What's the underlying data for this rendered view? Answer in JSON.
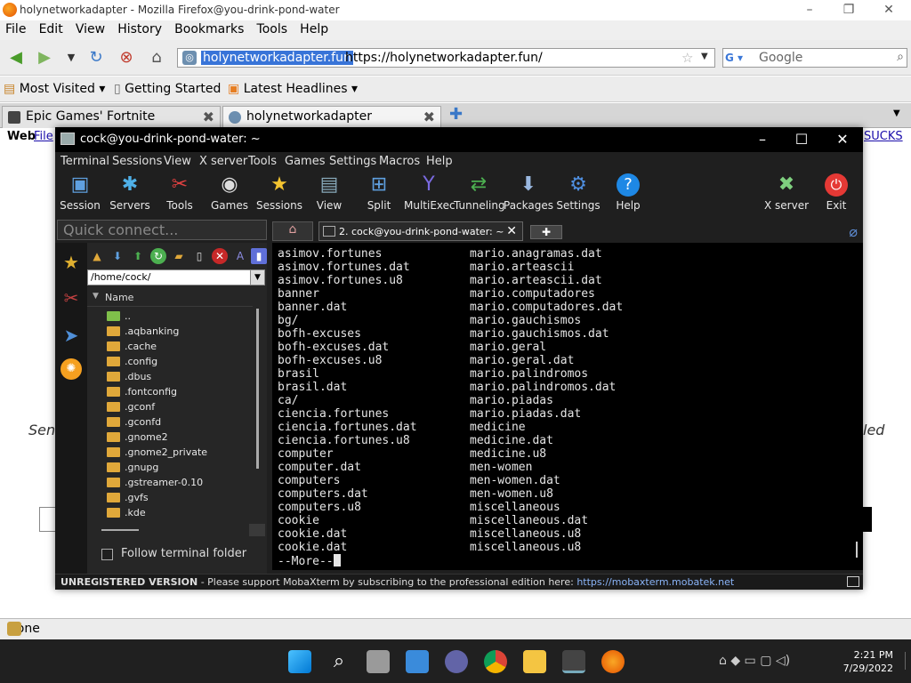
{
  "firefox": {
    "title": "holynetworkadapter - Mozilla Firefox@you-drink-pond-water",
    "menu": [
      "File",
      "Edit",
      "View",
      "History",
      "Bookmarks",
      "Tools",
      "Help"
    ],
    "url_selected": "holynetworkadapter.fun",
    "url": "https://holynetworkadapter.fun/",
    "search_placeholder": "Google",
    "bookmarks": [
      "Most Visited",
      "Getting Started",
      "Latest Headlines"
    ],
    "tabs": [
      {
        "label": "Epic Games' Fortnite",
        "active": false
      },
      {
        "label": "holynetworkadapter",
        "active": true
      }
    ],
    "status": "Done",
    "page_fragments": {
      "web": "Web",
      "file": "File",
      "sucks": "SUCKS",
      "sen": "Sen",
      "led": "led"
    }
  },
  "taskbar": {
    "time": "2:21 PM",
    "date": "7/29/2022"
  },
  "moba": {
    "title": "cock@you-drink-pond-water: ~",
    "menu": [
      "Terminal",
      "Sessions",
      "View",
      "X server",
      "Tools",
      "Games",
      "Settings",
      "Macros",
      "Help"
    ],
    "tools": [
      "Session",
      "Servers",
      "Tools",
      "Games",
      "Sessions",
      "View",
      "Split",
      "MultiExec",
      "Tunneling",
      "Packages",
      "Settings",
      "Help"
    ],
    "tools_right": [
      "X server",
      "Exit"
    ],
    "quick_connect": "Quick connect...",
    "tab_label": "2. cock@you-drink-pond-water: ~",
    "path": "/home/cock/",
    "name_header": "Name",
    "files": [
      "..",
      ".aqbanking",
      ".cache",
      ".config",
      ".dbus",
      ".fontconfig",
      ".gconf",
      ".gconfd",
      ".gnome2",
      ".gnome2_private",
      ".gnupg",
      ".gstreamer-0.10",
      ".gvfs",
      ".kde"
    ],
    "follow_label": "Follow terminal folder",
    "terminal_left": [
      "asimov.fortunes",
      "asimov.fortunes.dat",
      "asimov.fortunes.u8",
      "banner",
      "banner.dat",
      "bg/",
      "bofh-excuses",
      "bofh-excuses.dat",
      "bofh-excuses.u8",
      "brasil",
      "brasil.dat",
      "ca/",
      "ciencia.fortunes",
      "ciencia.fortunes.dat",
      "ciencia.fortunes.u8",
      "computer",
      "computer.dat",
      "computers",
      "computers.dat",
      "computers.u8",
      "cookie",
      "cookie.dat",
      "cookie.dat"
    ],
    "terminal_right": [
      "mario.anagramas.dat",
      "mario.arteascii",
      "mario.arteascii.dat",
      "mario.computadores",
      "mario.computadores.dat",
      "mario.gauchismos",
      "mario.gauchismos.dat",
      "mario.geral",
      "mario.geral.dat",
      "mario.palindromos",
      "mario.palindromos.dat",
      "mario.piadas",
      "mario.piadas.dat",
      "medicine",
      "medicine.dat",
      "medicine.u8",
      "men-women",
      "men-women.dat",
      "men-women.u8",
      "miscellaneous",
      "miscellaneous.dat",
      "miscellaneous.u8",
      "miscellaneous.u8"
    ],
    "more_prompt": "--More--",
    "status_unregistered": "UNREGISTERED VERSION",
    "status_msg": "-  Please support MobaXterm by subscribing to the professional edition here:",
    "status_link": "https://mobaxterm.mobatek.net"
  }
}
